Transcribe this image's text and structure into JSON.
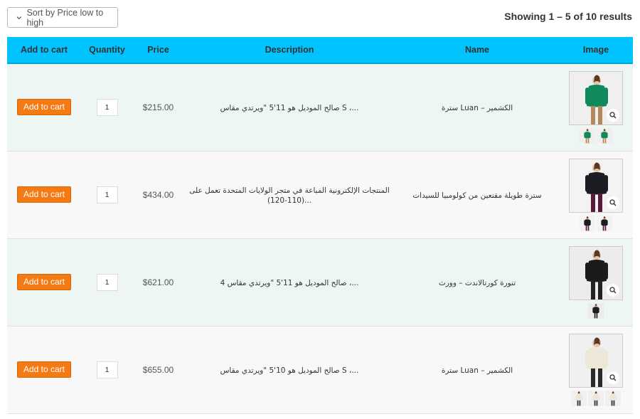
{
  "toolbar": {
    "sort_label": "Sort by Price low to high",
    "result_count": "Showing 1 – 5 of 10 results"
  },
  "table": {
    "headers": [
      "Add to cart",
      "Quantity",
      "Price",
      "Description",
      "Name",
      "Image"
    ],
    "rows": [
      {
        "add_label": "Add to cart",
        "qty": "1",
        "price": "$215.00",
        "description": "صالح الموديل هو 11'5 \"ويرتدي مقاس S ،...",
        "name": "سترة Luan – الكشمير",
        "image_icon": "green-sweater-model-image",
        "thumb_count": 2,
        "colors": {
          "garment": "#0f8a5c",
          "bg": "#efefef",
          "legs": "#b58a5a"
        }
      },
      {
        "add_label": "Add to cart",
        "qty": "1",
        "price": "$434.00",
        "description": "المنتجات الإلكترونية المباعة في متجر الولايات المتحدة تعمل على (110-120)...",
        "name": "سترة طويلة مقنعين من كولومبيا للسيدات",
        "image_icon": "black-jacket-image",
        "thumb_count": 2,
        "colors": {
          "garment": "#1c1c22",
          "bg": "#f3f3f3",
          "legs": "#5a1a3a"
        }
      },
      {
        "add_label": "Add to cart",
        "qty": "1",
        "price": "$621.00",
        "description": "صالح الموديل هو 11'5 \"ويرتدي مقاس 4 ،...",
        "name": "تنورة كورتالاندت – وورث",
        "image_icon": "black-dress-model-image",
        "thumb_count": 1,
        "colors": {
          "garment": "#1b1b1b",
          "bg": "#ececec",
          "legs": "#222222"
        }
      },
      {
        "add_label": "Add to cart",
        "qty": "1",
        "price": "$655.00",
        "description": "صالح الموديل هو 10'5 \"ويرتدي مقاس S ،...",
        "name": "سترة Luan – الكشمير",
        "image_icon": "white-sweater-model-image",
        "thumb_count": 3,
        "colors": {
          "garment": "#efe6da",
          "bg": "#f0f0f0",
          "legs": "#2a2a2a"
        }
      }
    ]
  },
  "accent_colors": {
    "header_bg": "#00c3ff",
    "button_bg": "#f47a13",
    "row_alt_bg": "#eef6f3"
  }
}
